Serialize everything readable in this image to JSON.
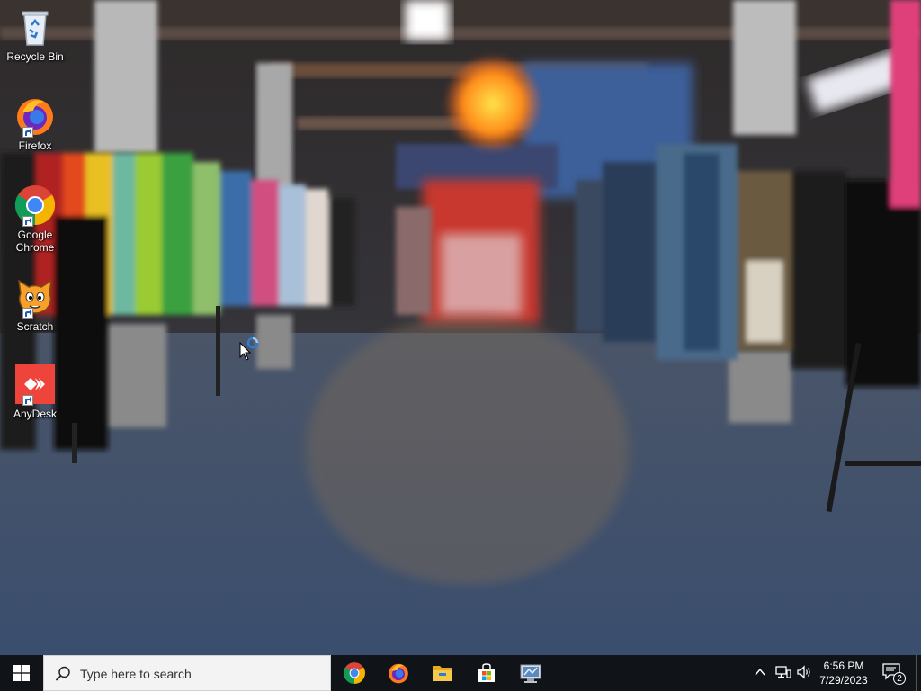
{
  "desktop": {
    "icons": [
      {
        "label": "Recycle Bin",
        "icon": "recycle-bin-icon",
        "shortcut": false
      },
      {
        "label": "Firefox",
        "icon": "firefox-icon",
        "shortcut": true
      },
      {
        "label": "Google Chrome",
        "icon": "chrome-icon",
        "shortcut": true
      },
      {
        "label": "Scratch",
        "icon": "scratch-icon",
        "shortcut": true
      },
      {
        "label": "AnyDesk",
        "icon": "anydesk-icon",
        "shortcut": true
      }
    ]
  },
  "taskbar": {
    "start_icon": "windows-logo-icon",
    "search_placeholder": "Type here to search",
    "pinned_apps": [
      {
        "name": "Google Chrome",
        "icon": "chrome-icon"
      },
      {
        "name": "Firefox",
        "icon": "firefox-icon"
      },
      {
        "name": "File Explorer",
        "icon": "file-explorer-icon"
      },
      {
        "name": "Microsoft Store",
        "icon": "store-icon"
      },
      {
        "name": "Control Panel",
        "icon": "control-panel-icon"
      }
    ],
    "tray": {
      "time": "6:56 PM",
      "date": "7/29/2023",
      "notification_count": "2"
    }
  },
  "colors": {
    "taskbar_bg": "#101418",
    "search_bg": "#f3f3f3",
    "accent": "#2f7bd8"
  }
}
